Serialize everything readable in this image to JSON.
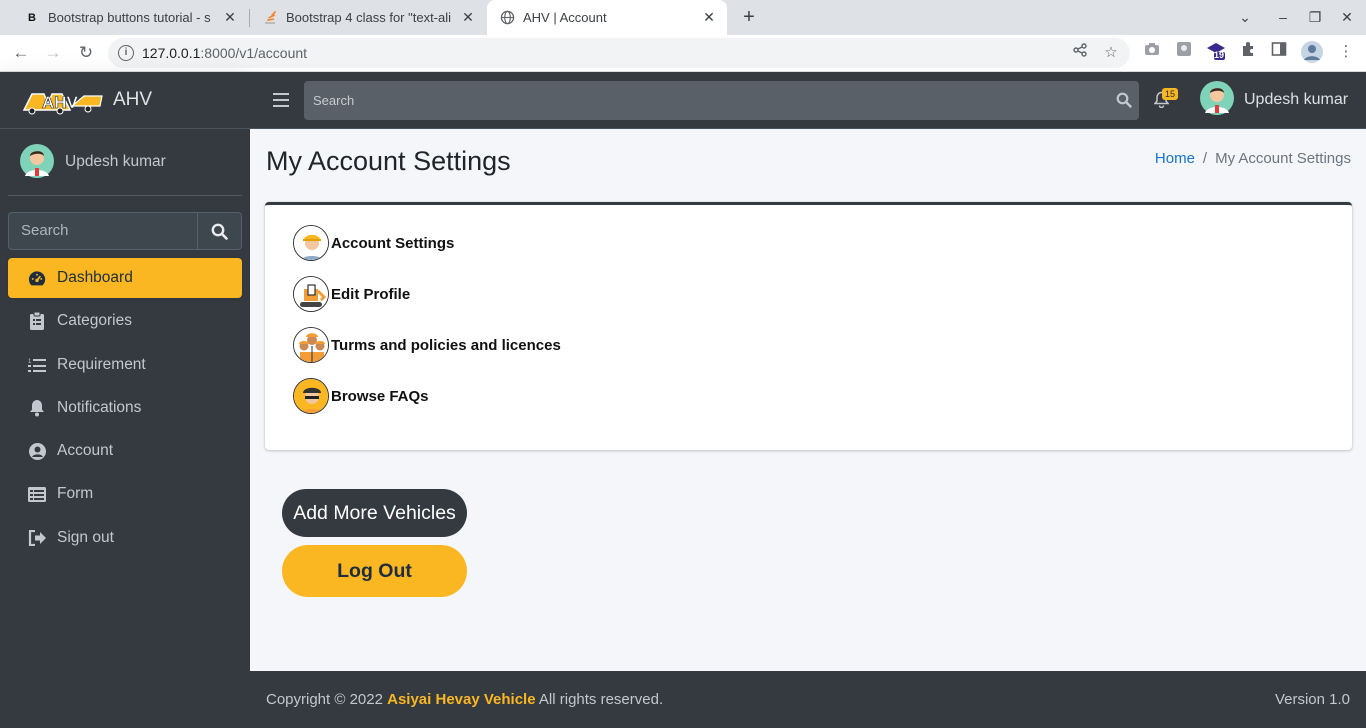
{
  "browser": {
    "tabs": [
      {
        "favicon": "B",
        "title": "Bootstrap buttons tutorial - s",
        "close": "✕"
      },
      {
        "favicon": "stackoverflow-icon",
        "title": "Bootstrap 4 class for \"text-ali",
        "close": "✕"
      },
      {
        "favicon": "globe-icon",
        "title": "AHV | Account",
        "close": "✕"
      }
    ],
    "new_tab": "+",
    "url_host": "127.0.0.1",
    "url_rest": ":8000/v1/account",
    "extension_badge": "19"
  },
  "brand": {
    "name": "AHV"
  },
  "sidebar": {
    "user_name": "Updesh kumar",
    "search_placeholder": "Search",
    "items": [
      {
        "label": "Dashboard",
        "icon": "tachometer-icon",
        "active": true
      },
      {
        "label": "Categories",
        "icon": "clipboard-icon"
      },
      {
        "label": "Requirement",
        "icon": "list-icon"
      },
      {
        "label": "Notifications",
        "icon": "bell-icon"
      },
      {
        "label": "Account",
        "icon": "user-circle-icon"
      },
      {
        "label": "Form",
        "icon": "table-list-icon"
      },
      {
        "label": "Sign out",
        "icon": "sign-out-icon"
      }
    ]
  },
  "topnav": {
    "search_placeholder": "Search",
    "notification_count": "15",
    "user_name": "Updesh kumar"
  },
  "page": {
    "title": "My Account Settings",
    "breadcrumb": {
      "home": "Home",
      "separator": "/",
      "current": "My Account Settings"
    },
    "options": [
      {
        "label": "Account Settings",
        "icon": "worker-avatar-icon"
      },
      {
        "label": "Edit Profile",
        "icon": "excavator-avatar-icon"
      },
      {
        "label": "Turms and policies and licences",
        "icon": "team-avatar-icon"
      },
      {
        "label": "Browse FAQs",
        "icon": "driver-avatar-icon"
      }
    ],
    "add_vehicles_label": "Add More Vehicles",
    "logout_label": "Log Out"
  },
  "footer": {
    "copyright_prefix": "Copyright © 2022",
    "brand_name": "Asiyai Hevay Vehicle",
    "copyright_suffix": "All rights reserved.",
    "version": "Version 1.0"
  },
  "colors": {
    "accent": "#fbb722",
    "sidebar": "#343a40",
    "link": "#1874c8"
  }
}
